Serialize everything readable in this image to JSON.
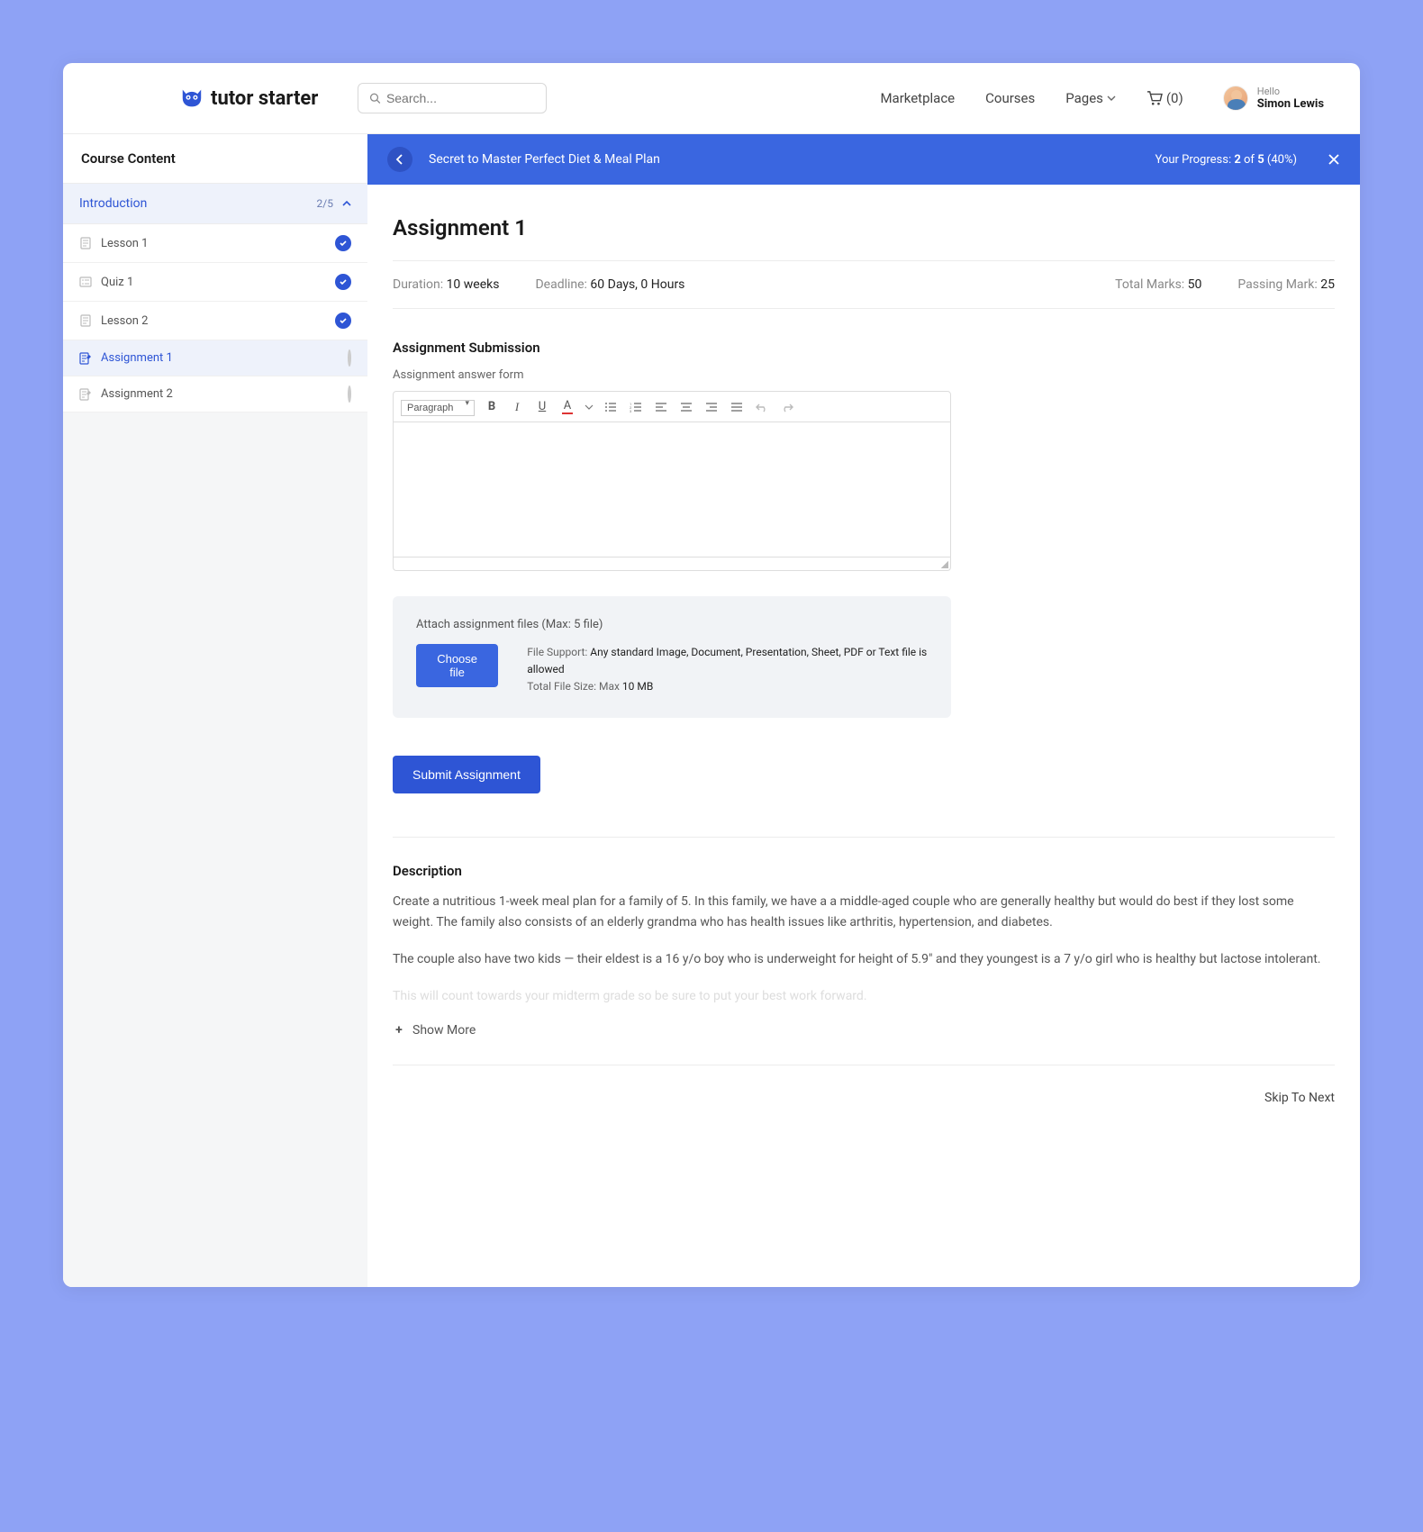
{
  "logo": {
    "brand": "tutor starter"
  },
  "search": {
    "placeholder": "Search..."
  },
  "nav": {
    "marketplace": "Marketplace",
    "courses": "Courses",
    "pages": "Pages",
    "cart_label": "(0)"
  },
  "user": {
    "hello": "Hello",
    "name": "Simon Lewis"
  },
  "sidebar": {
    "header": "Course Content",
    "section": {
      "title": "Introduction",
      "progress": "2/5"
    },
    "items": [
      {
        "label": "Lesson 1",
        "done": true,
        "type": "lesson"
      },
      {
        "label": "Quiz 1",
        "done": true,
        "type": "quiz"
      },
      {
        "label": "Lesson 2",
        "done": true,
        "type": "lesson"
      },
      {
        "label": "Assignment 1",
        "done": false,
        "type": "assignment",
        "active": true
      },
      {
        "label": "Assignment 2",
        "done": false,
        "type": "assignment"
      }
    ]
  },
  "coursebar": {
    "title": "Secret to Master Perfect Diet & Meal Plan",
    "progress_prefix": "Your Progress: ",
    "progress_done": "2",
    "progress_of": " of ",
    "progress_total": "5",
    "progress_pct": " (40%)"
  },
  "page": {
    "title": "Assignment 1",
    "meta": {
      "duration_label": "Duration: ",
      "duration_value": "10 weeks",
      "deadline_label": "Deadline: ",
      "deadline_value": "60 Days, 0 Hours",
      "total_label": "Total Marks: ",
      "total_value": "50",
      "passing_label": "Passing Mark: ",
      "passing_value": "25"
    },
    "submission_title": "Assignment Submission",
    "form_label": "Assignment answer form",
    "editor": {
      "paragraph": "Paragraph"
    },
    "attach": {
      "title": "Attach assignment files (Max: 5 file)",
      "choose": "Choose file",
      "support_label": "File Support: ",
      "support_value": "Any standard Image, Document, Presentation, Sheet, PDF or Text file is allowed",
      "size_label": "Total File Size: Max ",
      "size_value": "10 MB"
    },
    "submit": "Submit Assignment",
    "description": {
      "title": "Description",
      "p1": "Create a nutritious 1-week meal plan for a family of 5. In this family, we have a a middle-aged couple who are generally healthy but would do best if they lost some weight. The family also consists of an elderly grandma who has health issues like arthritis, hypertension, and diabetes.",
      "p2": "The couple also have two kids — their eldest is a 16 y/o boy who is underweight for height of 5.9\" and they youngest is a 7 y/o girl who is healthy but lactose intolerant.",
      "p3": "This will count towards your midterm grade so be sure to put your best work forward.",
      "show_more": "Show More"
    },
    "skip": "Skip To Next"
  }
}
